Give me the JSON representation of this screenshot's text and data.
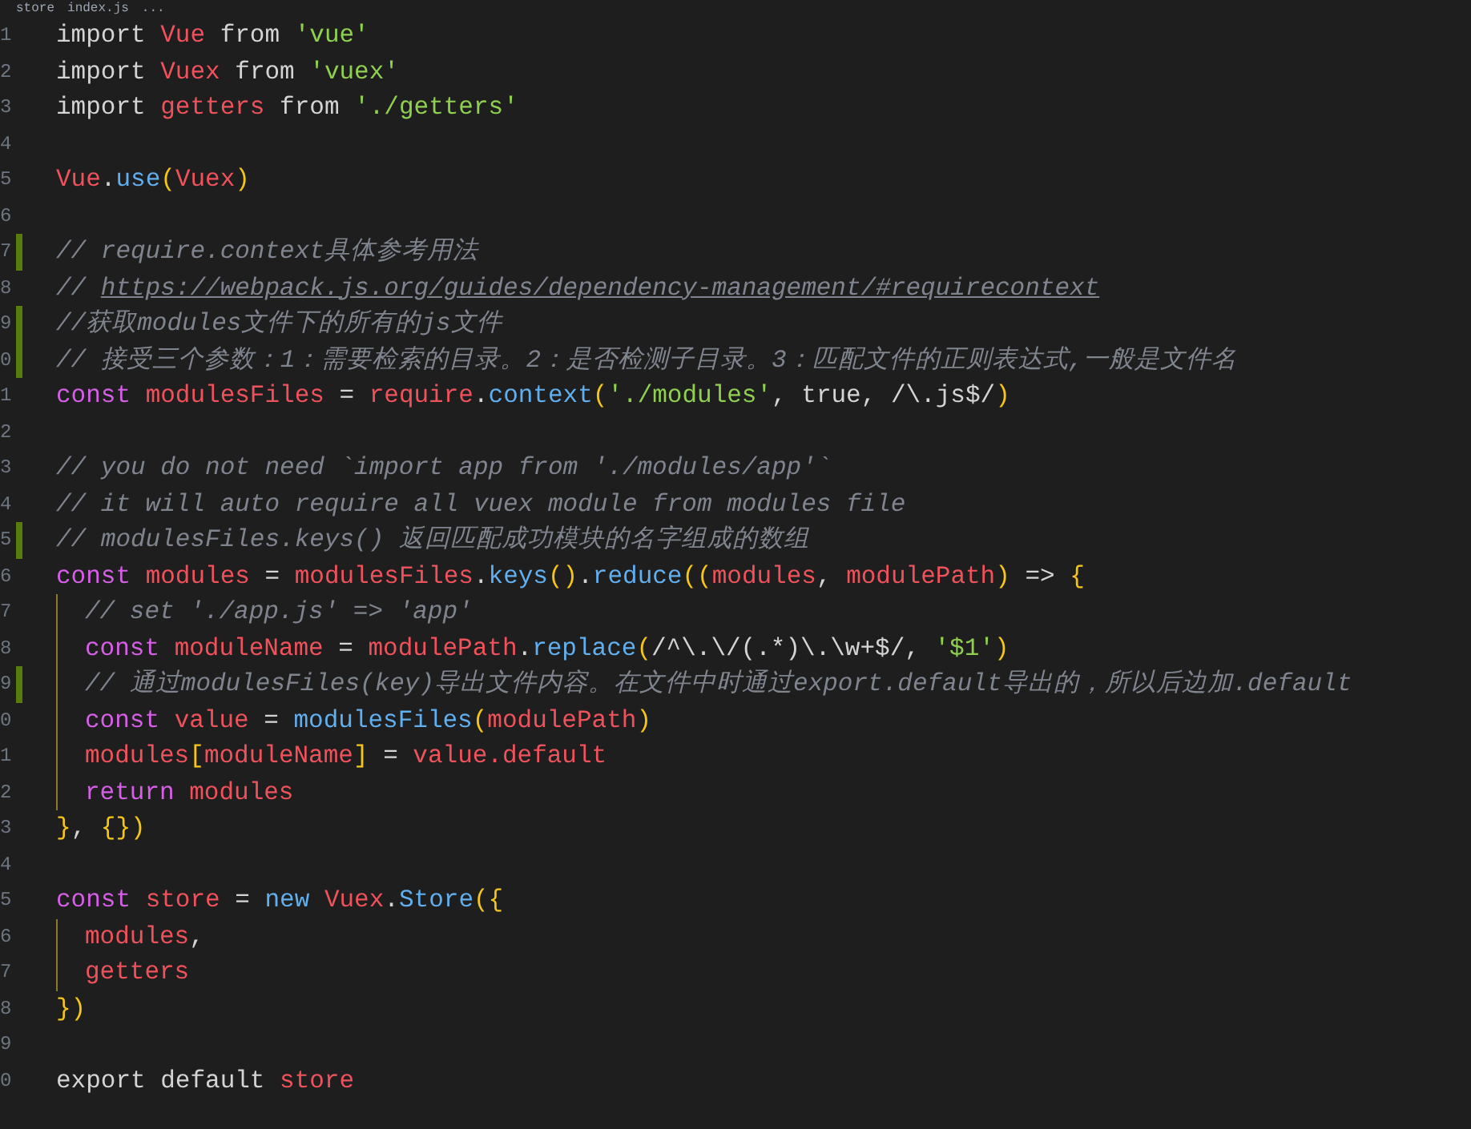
{
  "breadcrumb": [
    "store",
    "index.js",
    "..."
  ],
  "lines": [
    {
      "number": "1",
      "modified": false,
      "indented": false,
      "tokens": [
        {
          "kind": "plain",
          "text": "import "
        },
        {
          "kind": "var",
          "text": "Vue"
        },
        {
          "kind": "plain",
          "text": " from "
        },
        {
          "kind": "str",
          "text": "'vue'"
        }
      ]
    },
    {
      "number": "2",
      "modified": false,
      "indented": false,
      "tokens": [
        {
          "kind": "plain",
          "text": "import "
        },
        {
          "kind": "var",
          "text": "Vuex"
        },
        {
          "kind": "plain",
          "text": " from "
        },
        {
          "kind": "str",
          "text": "'vuex'"
        }
      ]
    },
    {
      "number": "3",
      "modified": false,
      "indented": false,
      "tokens": [
        {
          "kind": "plain",
          "text": "import "
        },
        {
          "kind": "var",
          "text": "getters"
        },
        {
          "kind": "plain",
          "text": " from "
        },
        {
          "kind": "str",
          "text": "'./getters'"
        }
      ]
    },
    {
      "number": "4",
      "modified": false,
      "indented": false
    },
    {
      "number": "5",
      "modified": false,
      "indented": false,
      "tokens": [
        {
          "kind": "var",
          "text": "Vue"
        },
        {
          "kind": "plain",
          "text": "."
        },
        {
          "kind": "fn",
          "text": "use"
        },
        {
          "kind": "br",
          "text": "("
        },
        {
          "kind": "var",
          "text": "Vuex"
        },
        {
          "kind": "br",
          "text": ")"
        }
      ]
    },
    {
      "number": "6",
      "modified": false,
      "indented": false
    },
    {
      "number": "7",
      "modified": true,
      "indented": false,
      "tokens": [
        {
          "kind": "cm",
          "text": "// require.context具体参考用法"
        }
      ]
    },
    {
      "number": "8",
      "modified": false,
      "indented": false,
      "tokens": [
        {
          "kind": "cm",
          "text": "// "
        },
        {
          "kind": "url",
          "text": "https://webpack.js.org/guides/dependency-management/#requirecontext"
        }
      ]
    },
    {
      "number": "9",
      "modified": true,
      "indented": false,
      "tokens": [
        {
          "kind": "cm",
          "text": "//获取modules文件下的所有的js文件"
        }
      ]
    },
    {
      "number": "0",
      "modified": true,
      "indented": false,
      "tokens": [
        {
          "kind": "cm",
          "text": "// 接受三个参数：1：需要检索的目录。2：是否检测子目录。3：匹配文件的正则表达式,一般是文件名"
        }
      ]
    },
    {
      "number": "1",
      "modified": false,
      "indented": false,
      "tokens": [
        {
          "kind": "kw",
          "text": "const "
        },
        {
          "kind": "var",
          "text": "modulesFiles"
        },
        {
          "kind": "plain",
          "text": " = "
        },
        {
          "kind": "var",
          "text": "require"
        },
        {
          "kind": "plain",
          "text": "."
        },
        {
          "kind": "fn",
          "text": "context"
        },
        {
          "kind": "br",
          "text": "("
        },
        {
          "kind": "str",
          "text": "'./modules'"
        },
        {
          "kind": "plain",
          "text": ", true, /\\.js$/"
        },
        {
          "kind": "br",
          "text": ")"
        }
      ]
    },
    {
      "number": "2",
      "modified": false,
      "indented": false
    },
    {
      "number": "3",
      "modified": false,
      "indented": false,
      "tokens": [
        {
          "kind": "cm",
          "text": "// you do not need `import app from './modules/app'`"
        }
      ]
    },
    {
      "number": "4",
      "modified": false,
      "indented": false,
      "tokens": [
        {
          "kind": "cm",
          "text": "// it will auto require all vuex module from modules file"
        }
      ]
    },
    {
      "number": "5",
      "modified": true,
      "indented": false,
      "tokens": [
        {
          "kind": "cm",
          "text": "// modulesFiles.keys() 返回匹配成功模块的名字组成的数组"
        }
      ]
    },
    {
      "number": "6",
      "modified": false,
      "indented": false,
      "tokens": [
        {
          "kind": "kw",
          "text": "const "
        },
        {
          "kind": "var",
          "text": "modules"
        },
        {
          "kind": "plain",
          "text": " = "
        },
        {
          "kind": "var",
          "text": "modulesFiles"
        },
        {
          "kind": "plain",
          "text": "."
        },
        {
          "kind": "fn",
          "text": "keys"
        },
        {
          "kind": "br",
          "text": "()"
        },
        {
          "kind": "plain",
          "text": "."
        },
        {
          "kind": "fn",
          "text": "reduce"
        },
        {
          "kind": "br",
          "text": "(("
        },
        {
          "kind": "var",
          "text": "modules"
        },
        {
          "kind": "plain",
          "text": ", "
        },
        {
          "kind": "var",
          "text": "modulePath"
        },
        {
          "kind": "br",
          "text": ")"
        },
        {
          "kind": "plain",
          "text": " => "
        },
        {
          "kind": "br",
          "text": "{"
        }
      ]
    },
    {
      "number": "7",
      "modified": false,
      "indented": true,
      "tokens": [
        {
          "kind": "cm",
          "text": "// set './app.js' => 'app'"
        }
      ]
    },
    {
      "number": "8",
      "modified": false,
      "indented": true,
      "tokens": [
        {
          "kind": "kw",
          "text": "const "
        },
        {
          "kind": "var",
          "text": "moduleName"
        },
        {
          "kind": "plain",
          "text": " = "
        },
        {
          "kind": "var",
          "text": "modulePath"
        },
        {
          "kind": "plain",
          "text": "."
        },
        {
          "kind": "fn",
          "text": "replace"
        },
        {
          "kind": "br",
          "text": "("
        },
        {
          "kind": "plain",
          "text": "/^\\.\\/(.*)\\.\\w+$/, "
        },
        {
          "kind": "str",
          "text": "'$1'"
        },
        {
          "kind": "br",
          "text": ")"
        }
      ]
    },
    {
      "number": "9",
      "modified": true,
      "indented": true,
      "tokens": [
        {
          "kind": "cm",
          "text": "// 通过modulesFiles(key)导出文件内容。在文件中时通过export.default导出的，所以后边加.default"
        }
      ]
    },
    {
      "number": "0",
      "modified": false,
      "indented": true,
      "tokens": [
        {
          "kind": "kw",
          "text": "const "
        },
        {
          "kind": "var",
          "text": "value"
        },
        {
          "kind": "plain",
          "text": " = "
        },
        {
          "kind": "fn",
          "text": "modulesFiles"
        },
        {
          "kind": "br",
          "text": "("
        },
        {
          "kind": "var",
          "text": "modulePath"
        },
        {
          "kind": "br",
          "text": ")"
        }
      ]
    },
    {
      "number": "1",
      "modified": false,
      "indented": true,
      "tokens": [
        {
          "kind": "var",
          "text": "modules"
        },
        {
          "kind": "br",
          "text": "["
        },
        {
          "kind": "var",
          "text": "moduleName"
        },
        {
          "kind": "br",
          "text": "]"
        },
        {
          "kind": "plain",
          "text": " = "
        },
        {
          "kind": "var",
          "text": "value.default"
        }
      ]
    },
    {
      "number": "2",
      "modified": false,
      "indented": true,
      "tokens": [
        {
          "kind": "kw",
          "text": "return "
        },
        {
          "kind": "var",
          "text": "modules"
        }
      ]
    },
    {
      "number": "3",
      "modified": false,
      "indented": false,
      "tokens": [
        {
          "kind": "br",
          "text": "}"
        },
        {
          "kind": "plain",
          "text": ", "
        },
        {
          "kind": "br",
          "text": "{})"
        }
      ]
    },
    {
      "number": "4",
      "modified": false,
      "indented": false
    },
    {
      "number": "5",
      "modified": false,
      "indented": false,
      "tokens": [
        {
          "kind": "kw",
          "text": "const "
        },
        {
          "kind": "var",
          "text": "store"
        },
        {
          "kind": "plain",
          "text": " = "
        },
        {
          "kind": "fn",
          "text": "new "
        },
        {
          "kind": "var",
          "text": "Vuex"
        },
        {
          "kind": "plain",
          "text": "."
        },
        {
          "kind": "fn",
          "text": "Store"
        },
        {
          "kind": "br",
          "text": "({"
        }
      ]
    },
    {
      "number": "6",
      "modified": false,
      "indented": true,
      "tokens": [
        {
          "kind": "var",
          "text": "modules"
        },
        {
          "kind": "plain",
          "text": ","
        }
      ]
    },
    {
      "number": "7",
      "modified": false,
      "indented": true,
      "tokens": [
        {
          "kind": "var",
          "text": "getters"
        }
      ]
    },
    {
      "number": "8",
      "modified": false,
      "indented": false,
      "tokens": [
        {
          "kind": "br",
          "text": "})"
        }
      ]
    },
    {
      "number": "9",
      "modified": false,
      "indented": false
    },
    {
      "number": "0",
      "modified": false,
      "indented": false,
      "tokens": [
        {
          "kind": "plain",
          "text": "export default "
        },
        {
          "kind": "var",
          "text": "store"
        }
      ]
    }
  ]
}
